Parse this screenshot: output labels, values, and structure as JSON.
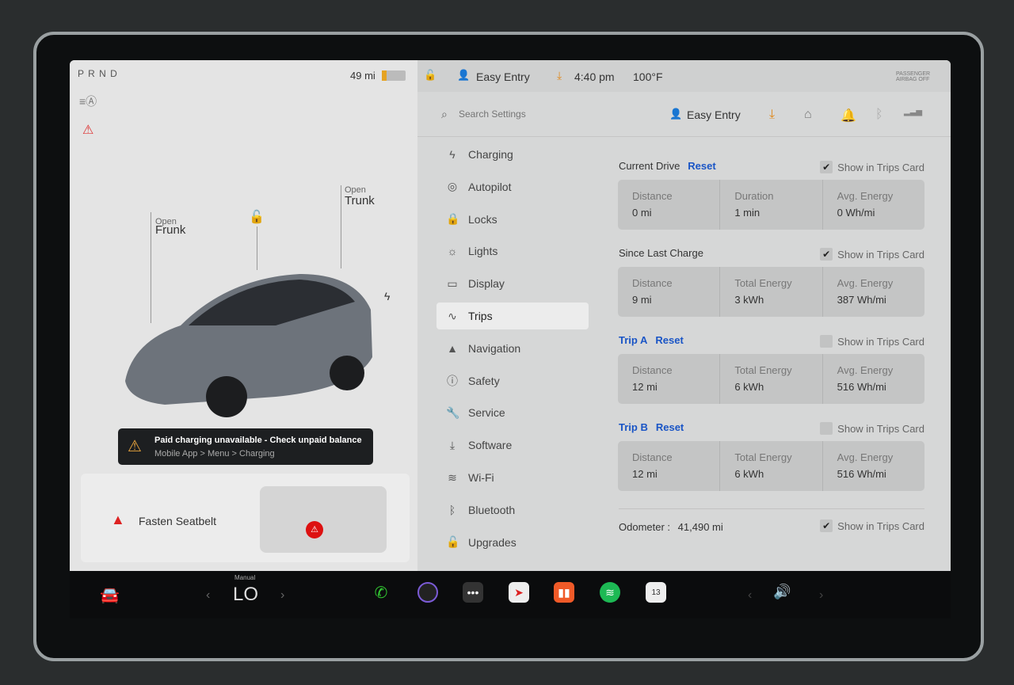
{
  "status": {
    "gear": "P R N D",
    "range": "49 mi",
    "user": "Easy Entry",
    "time": "4:40 pm",
    "temp": "100°F",
    "airbag": "PASSENGER AIRBAG OFF"
  },
  "car": {
    "frunk_label": "Open",
    "frunk": "Frunk",
    "trunk_label": "Open",
    "trunk": "Trunk"
  },
  "alert": {
    "title": "Paid charging unavailable - Check unpaid balance",
    "subtitle": "Mobile App > Menu > Charging"
  },
  "seatbelt": {
    "text": "Fasten Seatbelt"
  },
  "settings": {
    "search_placeholder": "Search Settings",
    "profile": "Easy Entry",
    "menu": [
      {
        "label": "Charging",
        "icon": "bolt"
      },
      {
        "label": "Autopilot",
        "icon": "steering-wheel"
      },
      {
        "label": "Locks",
        "icon": "lock"
      },
      {
        "label": "Lights",
        "icon": "sun"
      },
      {
        "label": "Display",
        "icon": "display"
      },
      {
        "label": "Trips",
        "icon": "trips"
      },
      {
        "label": "Navigation",
        "icon": "arrow"
      },
      {
        "label": "Safety",
        "icon": "info"
      },
      {
        "label": "Service",
        "icon": "wrench"
      },
      {
        "label": "Software",
        "icon": "download"
      },
      {
        "label": "Wi-Fi",
        "icon": "wifi"
      },
      {
        "label": "Bluetooth",
        "icon": "bluetooth"
      },
      {
        "label": "Upgrades",
        "icon": "bag"
      }
    ],
    "active": "Trips"
  },
  "trips": {
    "show_label": "Show in Trips Card",
    "reset": "Reset",
    "sections": [
      {
        "title": "Current Drive",
        "reset": true,
        "checked": true,
        "cells": [
          {
            "label": "Distance",
            "value": "0 mi"
          },
          {
            "label": "Duration",
            "value": "1 min"
          },
          {
            "label": "Avg. Energy",
            "value": "0 Wh/mi"
          }
        ]
      },
      {
        "title": "Since Last Charge",
        "reset": false,
        "checked": true,
        "cells": [
          {
            "label": "Distance",
            "value": "9 mi"
          },
          {
            "label": "Total Energy",
            "value": "3 kWh"
          },
          {
            "label": "Avg. Energy",
            "value": "387 Wh/mi"
          }
        ]
      },
      {
        "title": "Trip A",
        "reset": true,
        "checked": false,
        "cells": [
          {
            "label": "Distance",
            "value": "12 mi"
          },
          {
            "label": "Total Energy",
            "value": "6 kWh"
          },
          {
            "label": "Avg. Energy",
            "value": "516 Wh/mi"
          }
        ]
      },
      {
        "title": "Trip B",
        "reset": true,
        "checked": false,
        "cells": [
          {
            "label": "Distance",
            "value": "12 mi"
          },
          {
            "label": "Total Energy",
            "value": "6 kWh"
          },
          {
            "label": "Avg. Energy",
            "value": "516 Wh/mi"
          }
        ]
      }
    ],
    "odometer_label": "Odometer :",
    "odometer": "41,490 mi",
    "odometer_checked": true
  },
  "climate": {
    "mode": "Manual",
    "temp": "LO"
  },
  "dock": {
    "calendar_day": "13"
  }
}
